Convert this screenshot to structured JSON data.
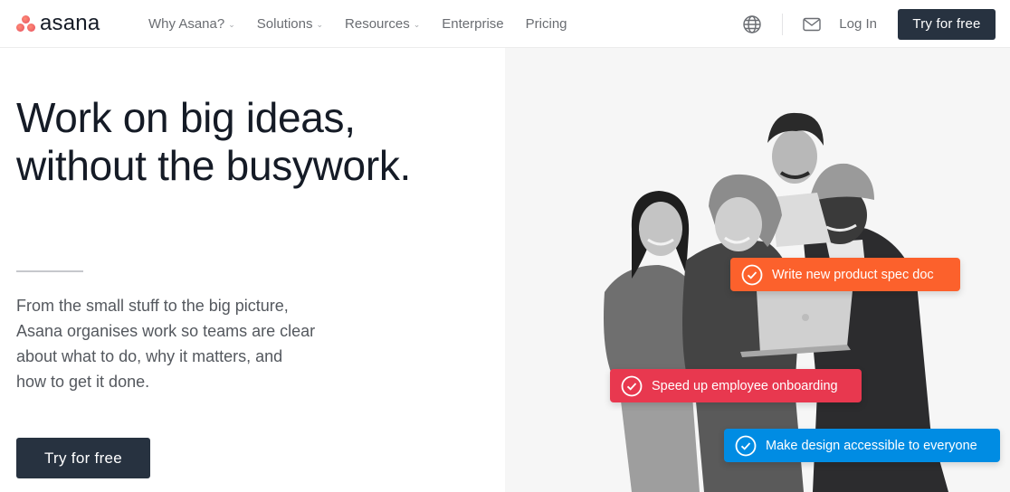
{
  "header": {
    "logo_text": "asana",
    "nav": [
      {
        "label": "Why Asana?",
        "has_dropdown": true
      },
      {
        "label": "Solutions",
        "has_dropdown": true
      },
      {
        "label": "Resources",
        "has_dropdown": true
      },
      {
        "label": "Enterprise",
        "has_dropdown": false
      },
      {
        "label": "Pricing",
        "has_dropdown": false
      }
    ],
    "dropdown_icon": "chevron-down-icon",
    "language_icon": "globe-icon",
    "contact_icon": "mail-icon",
    "login_label": "Log In",
    "cta_label": "Try for free"
  },
  "hero": {
    "title_line1": "Work on big ideas,",
    "title_line2": "without the busywork.",
    "body_lines": [
      "From the small stuff to the big picture,",
      "Asana organises work so teams are clear",
      "about what to do, why it matters, and",
      "how to get it done."
    ],
    "cta_label": "Try for free"
  },
  "illustration": {
    "description": "Four smiling people gathered around a laptop",
    "tasks": [
      {
        "label": "Write new product spec doc",
        "color": "#fc612c",
        "icon": "check-circle-icon"
      },
      {
        "label": "Speed up employee onboarding",
        "color": "#e8384f",
        "icon": "check-circle-icon"
      },
      {
        "label": "Make design accessible to everyone",
        "color": "#008ce3",
        "icon": "check-circle-icon"
      }
    ]
  },
  "colors": {
    "brand_coral": "#f06a6a",
    "button_dark": "#273240",
    "panel_bg": "#f6f6f6"
  }
}
